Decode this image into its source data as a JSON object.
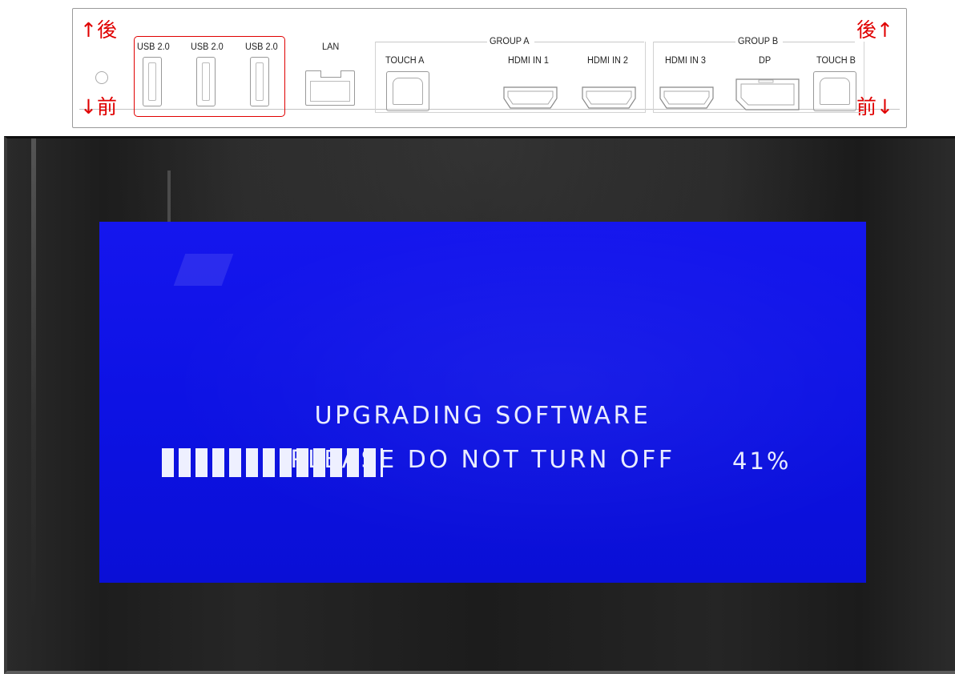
{
  "panel": {
    "usb_ports": [
      "USB 2.0",
      "USB 2.0",
      "USB 2.0"
    ],
    "lan_label": "LAN",
    "touch_a_label": "TOUCH A",
    "group_a": {
      "label": "GROUP A",
      "hdmi_in_1": "HDMI IN 1",
      "hdmi_in_2": "HDMI IN 2"
    },
    "group_b": {
      "label": "GROUP B",
      "hdmi_in_3": "HDMI IN 3",
      "dp": "DP",
      "touch_b": "TOUCH B"
    },
    "markers": {
      "back_left": "↑後",
      "front_left": "↓前",
      "back_right": "後↑",
      "front_right": "前↓"
    },
    "highlight_color": "#e00000"
  },
  "tv_screen": {
    "line1": "UPGRADING SOFTWARE",
    "line2": "PLEASE DO NOT TURN OFF",
    "progress_percent": 41,
    "progress_text": "41%",
    "background_color": "#0d12e4",
    "text_color": "#e9ecff"
  }
}
